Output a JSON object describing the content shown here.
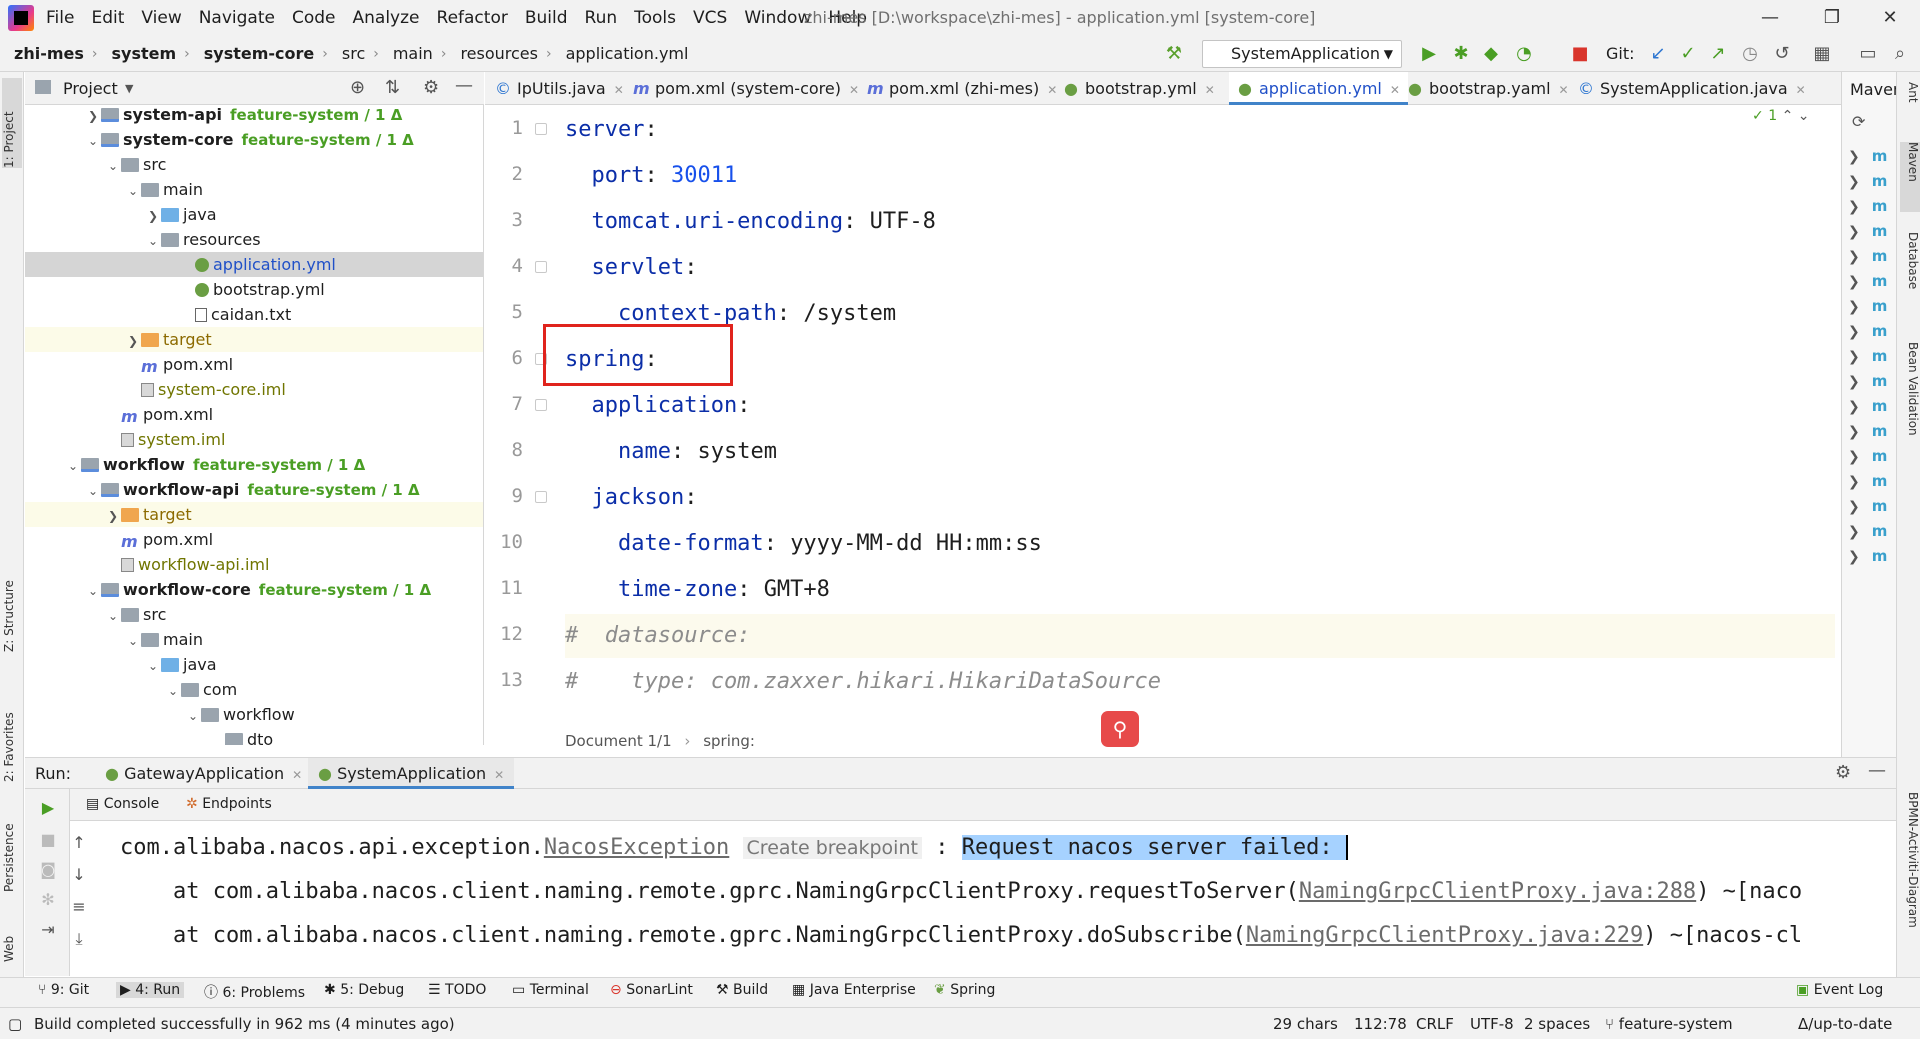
{
  "menu": [
    "File",
    "Edit",
    "View",
    "Navigate",
    "Code",
    "Analyze",
    "Refactor",
    "Build",
    "Run",
    "Tools",
    "VCS",
    "Window",
    "Help"
  ],
  "window_title": "zhi-mes [D:\\workspace\\zhi-mes] - application.yml [system-core]",
  "breadcrumb": [
    "zhi-mes",
    "system",
    "system-core",
    "src",
    "main",
    "resources",
    "application.yml"
  ],
  "run_config": "SystemApplication",
  "git_label": "Git:",
  "project_panel": {
    "title": "Project",
    "tree": [
      {
        "label": "system-api",
        "branch": "feature-system / 1 Δ",
        "type": "module"
      },
      {
        "label": "system-core",
        "branch": "feature-system / 1 Δ",
        "type": "module"
      },
      {
        "label": "src",
        "type": "folder"
      },
      {
        "label": "main",
        "type": "folder"
      },
      {
        "label": "java",
        "type": "folder-blue"
      },
      {
        "label": "resources",
        "type": "folder"
      },
      {
        "label": "application.yml",
        "type": "yml"
      },
      {
        "label": "bootstrap.yml",
        "type": "yml"
      },
      {
        "label": "caidan.txt",
        "type": "txt"
      },
      {
        "label": "target",
        "type": "folder-orange"
      },
      {
        "label": "pom.xml",
        "type": "maven"
      },
      {
        "label": "system-core.iml",
        "type": "iml"
      },
      {
        "label": "pom.xml",
        "type": "maven"
      },
      {
        "label": "system.iml",
        "type": "iml"
      },
      {
        "label": "workflow",
        "branch": "feature-system / 1 Δ",
        "type": "module"
      },
      {
        "label": "workflow-api",
        "branch": "feature-system / 1 Δ",
        "type": "module"
      },
      {
        "label": "target",
        "type": "folder-orange"
      },
      {
        "label": "pom.xml",
        "type": "maven"
      },
      {
        "label": "workflow-api.iml",
        "type": "iml"
      },
      {
        "label": "workflow-core",
        "branch": "feature-system / 1 Δ",
        "type": "module"
      },
      {
        "label": "src",
        "type": "folder"
      },
      {
        "label": "main",
        "type": "folder"
      },
      {
        "label": "java",
        "type": "folder-blue"
      },
      {
        "label": "com",
        "type": "folder"
      },
      {
        "label": "workflow",
        "type": "folder"
      },
      {
        "label": "dto",
        "type": "folder"
      }
    ]
  },
  "editor_tabs": [
    {
      "label": "IpUtils.java"
    },
    {
      "label": "pom.xml (system-core)"
    },
    {
      "label": "pom.xml (zhi-mes)"
    },
    {
      "label": "bootstrap.yml"
    },
    {
      "label": "application.yml",
      "active": true
    },
    {
      "label": "bootstrap.yaml"
    },
    {
      "label": "SystemApplication.java"
    }
  ],
  "editor": {
    "inspection_count": "1",
    "lines": [
      {
        "n": "1",
        "key": "server",
        "sep": ":",
        "value": ""
      },
      {
        "n": "2",
        "key": "  port",
        "sep": ": ",
        "value": "30011"
      },
      {
        "n": "3",
        "key": "  tomcat.uri-encoding",
        "sep": ": ",
        "value": "UTF-8"
      },
      {
        "n": "4",
        "key": "  servlet",
        "sep": ":",
        "value": ""
      },
      {
        "n": "5",
        "key": "    context-path",
        "sep": ": ",
        "value": "/system"
      },
      {
        "n": "6",
        "key": "spring",
        "sep": ":",
        "value": ""
      },
      {
        "n": "7",
        "key": "  application",
        "sep": ":",
        "value": ""
      },
      {
        "n": "8",
        "key": "    name",
        "sep": ": ",
        "value": "system"
      },
      {
        "n": "9",
        "key": "  jackson",
        "sep": ":",
        "value": ""
      },
      {
        "n": "10",
        "key": "    date-format",
        "sep": ": ",
        "value": "yyyy-MM-dd HH:mm:ss"
      },
      {
        "n": "11",
        "key": "    time-zone",
        "sep": ": ",
        "value": "GMT+8"
      },
      {
        "n": "12",
        "comment": "#  datasource:"
      },
      {
        "n": "13",
        "comment": "#    type: com.zaxxer.hikari.HikariDataSource"
      }
    ],
    "breadcrumb": [
      "Document 1/1",
      "spring:"
    ]
  },
  "maven_panel": {
    "title": "Maven"
  },
  "right_stripe": [
    "Ant",
    "Maven",
    "Database",
    "Bean Validation",
    "BPMN-Activiti-Diagram"
  ],
  "left_stripe": [
    "1: Project",
    "Z: Structure",
    "2: Favorites",
    "Persistence",
    "Web"
  ],
  "run_panel": {
    "label": "Run:",
    "tabs": [
      "GatewayApplication",
      "SystemApplication"
    ],
    "subtabs": [
      "Console",
      "Endpoints"
    ],
    "console": {
      "line1_prefix": "com.alibaba.nacos.api.exception.",
      "line1_link": "NacosException",
      "line1_hint": "Create breakpoint",
      "line1_sep": " : ",
      "line1_selected": "Request nacos server failed: ",
      "line2_prefix": "    at com.alibaba.nacos.client.naming.remote.gprc.NamingGrpcClientProxy.requestToServer(",
      "line2_link": "NamingGrpcClientProxy.java:288",
      "line2_suffix": ") ~[naco",
      "line3_prefix": "    at com.alibaba.nacos.client.naming.remote.gprc.NamingGrpcClientProxy.doSubscribe(",
      "line3_link": "NamingGrpcClientProxy.java:229",
      "line3_suffix": ") ~[nacos-cl"
    }
  },
  "tool_strip": [
    {
      "label": "9: Git"
    },
    {
      "label": "4: Run",
      "active": true
    },
    {
      "label": "6: Problems"
    },
    {
      "label": "5: Debug"
    },
    {
      "label": "TODO"
    },
    {
      "label": "Terminal"
    },
    {
      "label": "SonarLint"
    },
    {
      "label": "Build"
    },
    {
      "label": "Java Enterprise"
    },
    {
      "label": "Spring"
    },
    {
      "label": "Event Log"
    }
  ],
  "status_bar": {
    "message": "Build completed successfully in 962 ms (4 minutes ago)",
    "chars": "29 chars",
    "position": "112:78",
    "line_sep": "CRLF",
    "encoding": "UTF-8",
    "indent": "2 spaces",
    "branch": "feature-system",
    "vcs_status": "Δ/up-to-date"
  },
  "colors": {
    "accent": "#4083c9",
    "highlight_box": "#e0231d",
    "keyword": "#0b2ea8",
    "number": "#1750eb",
    "branch": "#4a9e24"
  }
}
